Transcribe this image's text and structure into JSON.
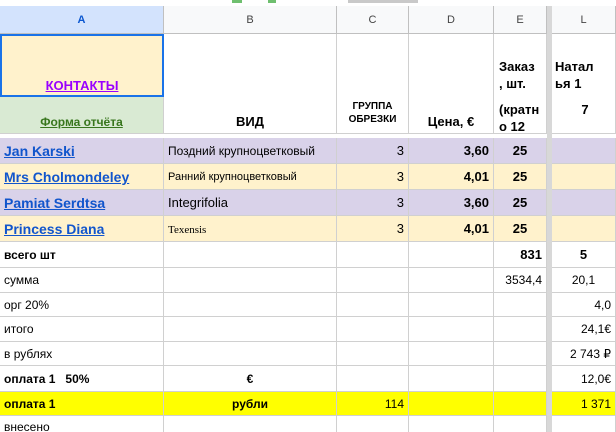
{
  "columns": {
    "a": "A",
    "b": "B",
    "c": "C",
    "d": "D",
    "e": "E",
    "l": "L"
  },
  "header": {
    "contacts_link": "КОНТАКТЫ",
    "report_form_link": "Форма отчёта",
    "vid": "ВИД",
    "group_line1": "ГРУППА",
    "group_line2": "ОБРЕЗКИ",
    "price": "Цена, €",
    "order_line1": "Заказ",
    "order_line2": ", шт.",
    "order_line3": "(кратн",
    "order_line4": "о 12",
    "natal_line1": "Натал",
    "natal_line2": "ья 1",
    "natal_num": "7"
  },
  "rows": [
    {
      "name": "Jan Karski",
      "type": "Поздний крупноцветковый",
      "group": "3",
      "price": "3,60",
      "order": "25"
    },
    {
      "name": "Mrs Cholmondeley",
      "type": "Ранний крупноцветковый",
      "group": "3",
      "price": "4,01",
      "order": "25"
    },
    {
      "name": "Pamiat Serdtsa",
      "type": "Integrifolia",
      "group": "3",
      "price": "3,60",
      "order": "25"
    },
    {
      "name": "Princess Diana",
      "type": "Texensis",
      "group": "3",
      "price": "4,01",
      "order": "25"
    }
  ],
  "summary": {
    "total_label": "всего шт",
    "total_e": "831",
    "total_l": "5",
    "sum_label": "сумма",
    "sum_e": "3534,4",
    "sum_l": "20,1",
    "org_label": "орг 20%",
    "org_l": "4,0",
    "itogo_label": "итого",
    "itogo_l": "24,1€",
    "rub_label": "в рублях",
    "rub_l": "2 743 ₽",
    "pay_eur_label": "оплата 1   50%",
    "pay_eur_b": "€",
    "pay_eur_l": "12,0€",
    "pay_rub_label": "оплата 1",
    "pay_rub_b": "рубли",
    "pay_rub_c": "114",
    "pay_rub_l": "1 371",
    "paid_label": "внесено"
  }
}
